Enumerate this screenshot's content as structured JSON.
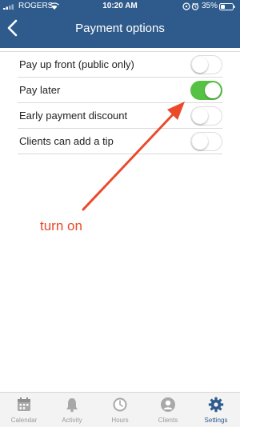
{
  "status_bar": {
    "carrier": "ROGERS",
    "time": "10:20 AM",
    "battery": "35%"
  },
  "header": {
    "title": "Payment options",
    "back_icon": "chevron-left-icon"
  },
  "options": [
    {
      "label": "Pay up front (public only)",
      "enabled": false
    },
    {
      "label": "Pay later",
      "enabled": true
    },
    {
      "label": "Early payment discount",
      "enabled": false
    },
    {
      "label": "Clients can add a tip",
      "enabled": false
    }
  ],
  "annotation": {
    "text": "turn on",
    "color": "#ea4a2a"
  },
  "tabbar": {
    "active": "Settings",
    "items": [
      {
        "label": "Calendar",
        "icon": "calendar-icon"
      },
      {
        "label": "Activity",
        "icon": "bell-icon"
      },
      {
        "label": "Hours",
        "icon": "clock-icon"
      },
      {
        "label": "Clients",
        "icon": "person-icon"
      },
      {
        "label": "Settings",
        "icon": "gear-icon"
      }
    ]
  },
  "colors": {
    "header": "#2f5b8c",
    "toggle_on": "#56c243",
    "tab_inactive": "#999999",
    "tab_active": "#2f5b8c"
  }
}
